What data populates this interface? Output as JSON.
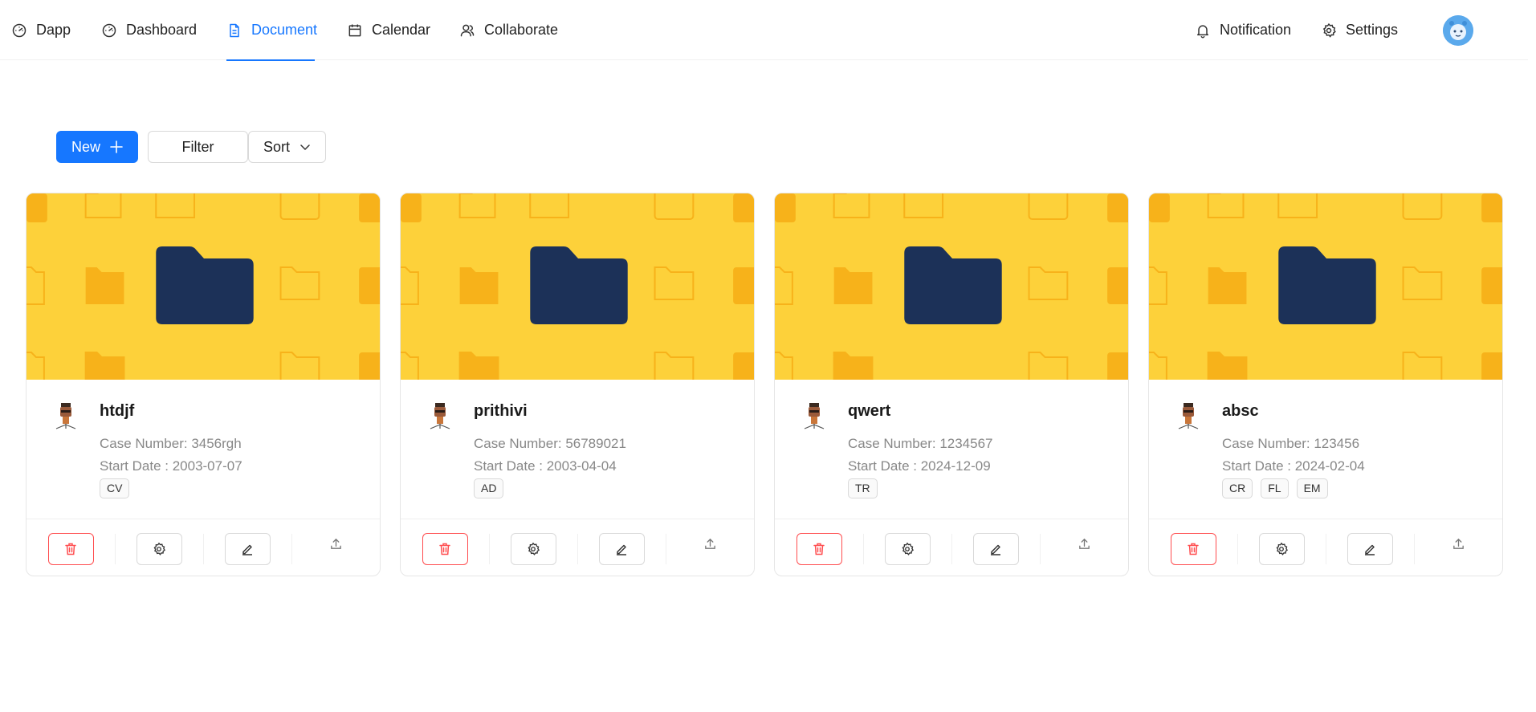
{
  "nav": {
    "brand": {
      "label": "Dapp",
      "icon": "dashboard-gauge-icon"
    },
    "items": [
      {
        "label": "Dashboard",
        "icon": "dashboard-gauge-icon"
      },
      {
        "label": "Document",
        "icon": "file-text-icon",
        "active": true
      },
      {
        "label": "Calendar",
        "icon": "calendar-icon"
      },
      {
        "label": "Collaborate",
        "icon": "user-group-icon"
      }
    ],
    "right": [
      {
        "label": "Notification",
        "icon": "bell-icon"
      },
      {
        "label": "Settings",
        "icon": "gear-icon"
      }
    ],
    "avatar_icon": "user-avatar-icon"
  },
  "toolbar": {
    "new_label": "New",
    "filter_label": "Filter",
    "sort_label": "Sort"
  },
  "colors": {
    "accent": "#1677ff",
    "cover_background": "#fdd13a",
    "folder_dark": "#1c3158",
    "danger": "#ff4d4f"
  },
  "cards": [
    {
      "title": "htdjf",
      "case_number": "Case Number: 3456rgh",
      "start_date": "Start Date : 2003-07-07",
      "tags": [
        "CV"
      ]
    },
    {
      "title": "prithivi",
      "case_number": "Case Number: 56789021",
      "start_date": "Start Date : 2003-04-04",
      "tags": [
        "AD"
      ]
    },
    {
      "title": "qwert",
      "case_number": "Case Number: 1234567",
      "start_date": "Start Date : 2024-12-09",
      "tags": [
        "TR"
      ]
    },
    {
      "title": "absc",
      "case_number": "Case Number: 123456",
      "start_date": "Start Date : 2024-02-04",
      "tags": [
        "CR",
        "FL",
        "EM"
      ]
    }
  ],
  "card_actions": [
    {
      "name": "delete",
      "icon": "trash-icon"
    },
    {
      "name": "settings",
      "icon": "gear-icon"
    },
    {
      "name": "edit",
      "icon": "pencil-edit-icon"
    },
    {
      "name": "share",
      "icon": "upload-share-icon"
    }
  ]
}
